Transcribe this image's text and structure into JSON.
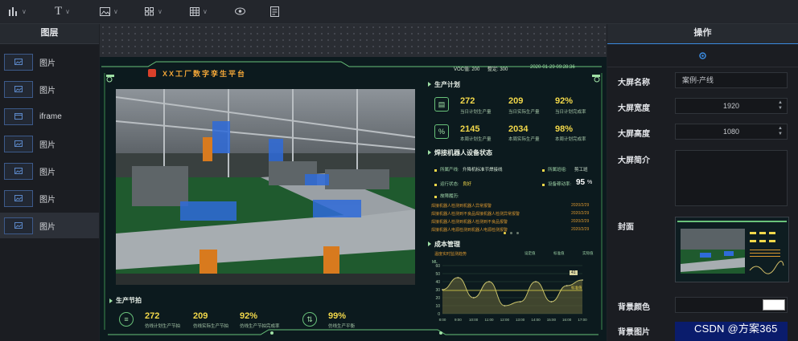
{
  "toolbar": {
    "items": [
      {
        "icon": "bar-chart-icon"
      },
      {
        "icon": "text-icon",
        "label": "T"
      },
      {
        "icon": "image-icon"
      },
      {
        "icon": "components-icon"
      },
      {
        "icon": "table-icon"
      },
      {
        "icon": "eye-icon"
      },
      {
        "icon": "document-icon"
      }
    ]
  },
  "layers": {
    "title": "图层",
    "items": [
      {
        "label": "图片"
      },
      {
        "label": "图片"
      },
      {
        "label": "iframe"
      },
      {
        "label": "图片"
      },
      {
        "label": "图片"
      },
      {
        "label": "图片"
      },
      {
        "label": "图片"
      }
    ]
  },
  "screen": {
    "title": "XX工厂数字孪生平台",
    "status": {
      "voc": "VOC值: 200",
      "temp": "整定: 300",
      "datetime": "2020-01-29 09:28:36"
    },
    "production_plan": {
      "title": "生产计划",
      "rows": [
        [
          {
            "value": "272",
            "label": "当日计划生产量"
          },
          {
            "value": "209",
            "label": "当日实际生产量"
          },
          {
            "value": "92%",
            "label": "当日计划完成率"
          }
        ],
        [
          {
            "value": "2145",
            "label": "本周计划生产量"
          },
          {
            "value": "2034",
            "label": "本周实际生产量"
          },
          {
            "value": "98%",
            "label": "本周计划完成率"
          }
        ]
      ]
    },
    "robot_status": {
      "title": "焊接机器人设备状态",
      "line_label": "所属产线:",
      "line_value": "升降机标准节焊接线",
      "station_label": "所属班组:",
      "station_value": "剪工班",
      "run_label": "运行状态:",
      "run_value": "良好",
      "util_label": "设备稼动率:",
      "util_value": "95",
      "util_unit": "%",
      "faults_title": "故障履历:",
      "faults": [
        {
          "text": "焊接机器人检测到机器人异常报警",
          "date": "2020/2/29"
        },
        {
          "text": "焊接机器人检测到不良品焊接机器人检测异常报警",
          "date": "2020/2/29"
        },
        {
          "text": "焊接机器人检测到机器人检测到不良品报警",
          "date": "2020/2/29"
        },
        {
          "text": "焊接机器人电源检测到机器人电源检测报警",
          "date": "2020/2/29"
        }
      ]
    },
    "cost": {
      "title": "成本管理",
      "subtitle": "温度实时监测趋势",
      "legend": [
        "设定值",
        "标准值",
        "实际值"
      ],
      "unit": "ML",
      "marker_label": "41",
      "end_label": "标准值"
    },
    "rhythm": {
      "title": "生产节拍",
      "items": [
        {
          "value": "272",
          "label": "仿线计划生产节拍"
        },
        {
          "value": "209",
          "label": "仿线实际生产节拍"
        },
        {
          "value": "92%",
          "label": "仿线生产节拍完成率"
        },
        {
          "value": "99%",
          "label": "仿线生产平衡"
        }
      ]
    }
  },
  "chart_data": {
    "type": "area",
    "x": [
      "8:00",
      "9:00",
      "10:00",
      "11:00",
      "12:00",
      "13:00",
      "14:00",
      "15:00",
      "16:00",
      "17:00"
    ],
    "series": [
      {
        "name": "实际值",
        "values": [
          30,
          45,
          20,
          40,
          10,
          15,
          40,
          15,
          35,
          42
        ]
      },
      {
        "name": "标准值",
        "values": [
          29,
          29,
          29,
          29,
          29,
          29,
          29,
          29,
          29,
          29
        ]
      }
    ],
    "ylim": [
      0,
      60
    ],
    "yticks": [
      0,
      10,
      20,
      30,
      40,
      50,
      60
    ]
  },
  "ops": {
    "title": "操作",
    "name_label": "大屏名称",
    "name_value": "案例-产线",
    "width_label": "大屏宽度",
    "width_value": "1920",
    "height_label": "大屏高度",
    "height_value": "1080",
    "desc_label": "大屏简介",
    "cover_label": "封面",
    "bgcolor_label": "背景颜色",
    "bgimage_label": "背景图片"
  },
  "watermark": "CSDN @方案365",
  "colors": {
    "accent": "#3b8be0",
    "screen_green": "#69c27a",
    "kpi_yellow": "#f2d84a"
  }
}
